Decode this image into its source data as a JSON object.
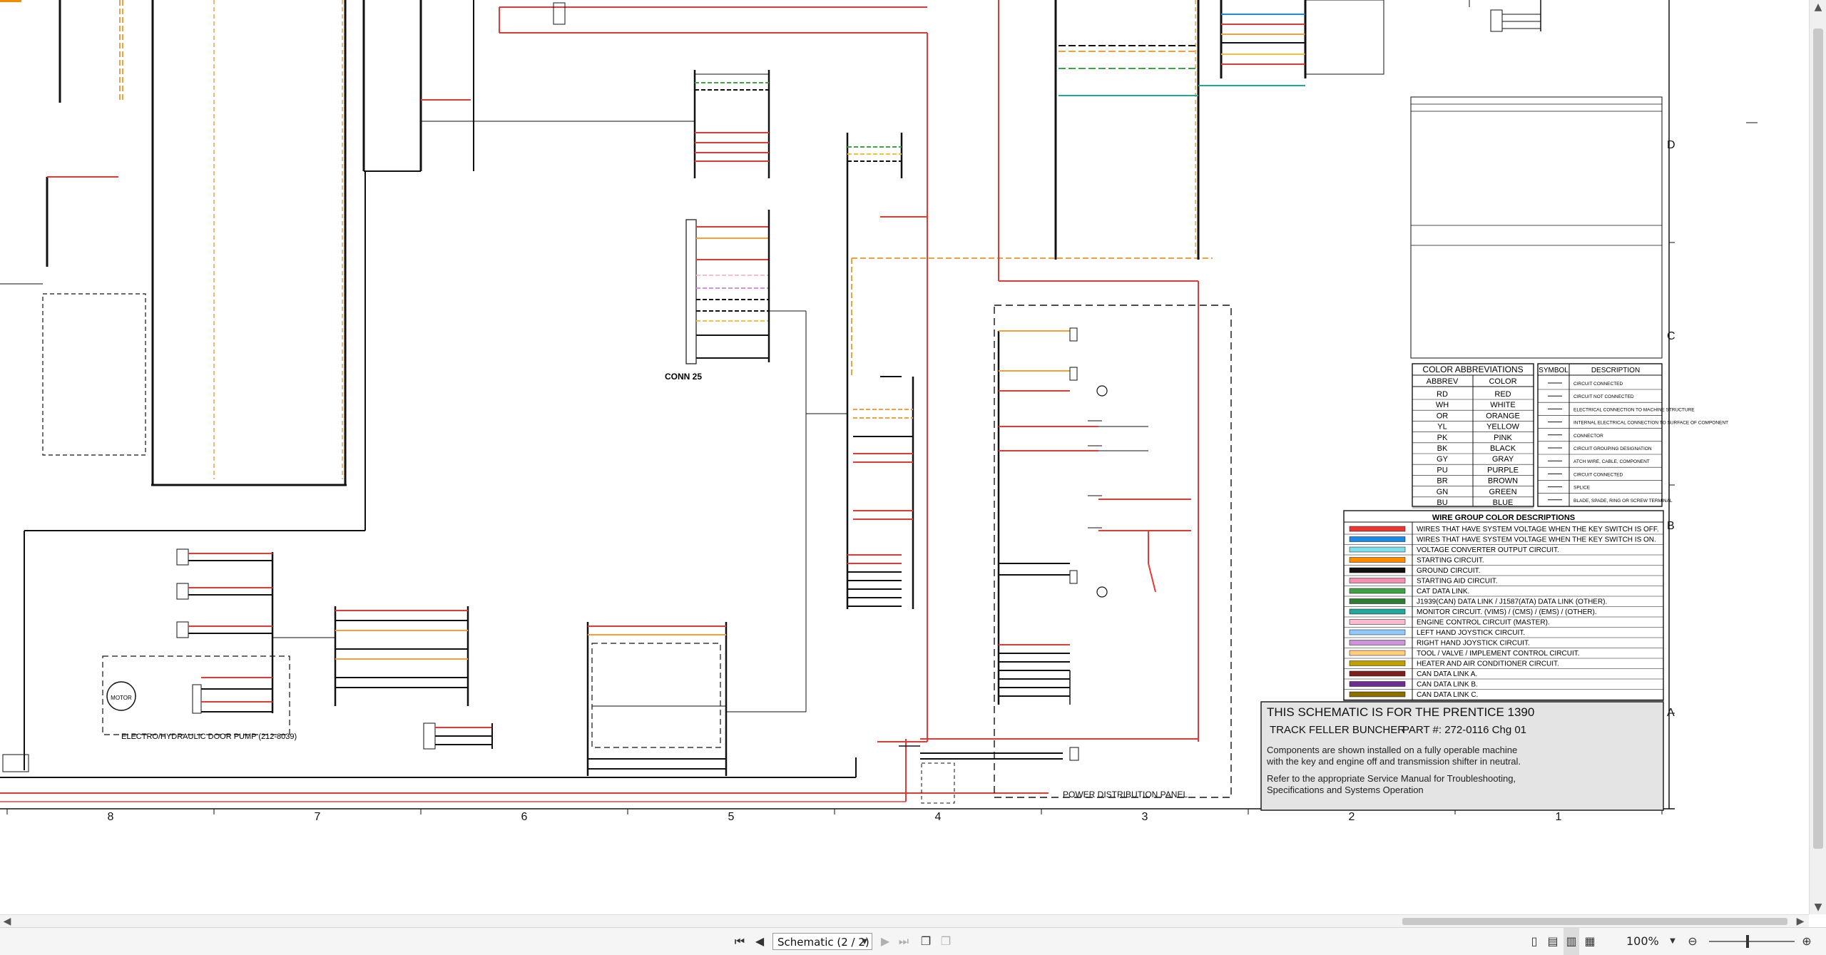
{
  "schematic": {
    "title_line1": "THIS SCHEMATIC IS FOR THE PRENTICE 1390",
    "title_line2_left": "TRACK FELLER BUNCHER",
    "title_line2_right": "PART #: 272-0116  Chg 01",
    "note1": "Components are shown installed on a fully operable machine",
    "note2": "with the key and engine off and transmission shifter in neutral.",
    "note3": "Refer to the appropriate Service Manual for Troubleshooting,",
    "note4": "Specifications and Systems Operation",
    "conn25": "CONN 25",
    "power_dist": "POWER DISTRIBUTION PANEL",
    "door_pump": "ELECTRO/HYDRAULIC DOOR PUMP (212-8039)",
    "motor": "MOTOR",
    "zone_numbers": [
      "8",
      "7",
      "6",
      "5",
      "4",
      "3",
      "2",
      "1"
    ],
    "row_letters": [
      "D",
      "C",
      "B",
      "A"
    ]
  },
  "color_abbrev": {
    "header": "COLOR ABBREVIATIONS",
    "col1": "ABBREV",
    "col2": "COLOR",
    "rows": [
      [
        "RD",
        "RED"
      ],
      [
        "WH",
        "WHITE"
      ],
      [
        "OR",
        "ORANGE"
      ],
      [
        "YL",
        "YELLOW"
      ],
      [
        "PK",
        "PINK"
      ],
      [
        "BK",
        "BLACK"
      ],
      [
        "GY",
        "GRAY"
      ],
      [
        "PU",
        "PURPLE"
      ],
      [
        "BR",
        "BROWN"
      ],
      [
        "GN",
        "GREEN"
      ],
      [
        "BU",
        "BLUE"
      ]
    ]
  },
  "symbols": {
    "col1": "SYMBOL",
    "col2": "DESCRIPTION",
    "rows": [
      "CIRCUIT CONNECTED",
      "CIRCUIT NOT CONNECTED",
      "ELECTRICAL CONNECTION TO MACHINE STRUCTURE",
      "INTERNAL ELECTRICAL CONNECTION TO SURFACE OF COMPONENT",
      "CONNECTOR",
      "CIRCUIT GROUPING DESIGNATION",
      "ATCH WIRE, CABLE, COMPONENT",
      "CIRCUIT CONNECTED",
      "SPLICE",
      "BLADE, SPADE, RING OR SCREW TERMINAL"
    ]
  },
  "wire_groups": {
    "header": "WIRE GROUP COLOR DESCRIPTIONS",
    "rows": [
      {
        "color": "#e53935",
        "label": "WIRES THAT HAVE SYSTEM VOLTAGE WHEN THE KEY SWITCH IS OFF."
      },
      {
        "color": "#1e88e5",
        "label": "WIRES THAT HAVE SYSTEM VOLTAGE WHEN THE KEY SWITCH IS ON."
      },
      {
        "color": "#80deea",
        "label": "VOLTAGE CONVERTER OUTPUT CIRCUIT."
      },
      {
        "color": "#fb8c00",
        "label": "STARTING CIRCUIT."
      },
      {
        "color": "#111111",
        "label": "GROUND CIRCUIT."
      },
      {
        "color": "#f48fb1",
        "label": "STARTING AID CIRCUIT."
      },
      {
        "color": "#43a047",
        "label": "CAT DATA LINK."
      },
      {
        "color": "#2e7d32",
        "label": "J1939(CAN) DATA LINK / J1587(ATA) DATA LINK (OTHER)."
      },
      {
        "color": "#26a69a",
        "label": "MONITOR CIRCUIT. (VIMS) / (CMS) / (EMS) / (OTHER)."
      },
      {
        "color": "#f8bbd0",
        "label": "ENGINE CONTROL CIRCUIT (MASTER)."
      },
      {
        "color": "#90caf9",
        "label": "LEFT HAND JOYSTICK CIRCUIT."
      },
      {
        "color": "#ce93d8",
        "label": "RIGHT HAND JOYSTICK CIRCUIT."
      },
      {
        "color": "#ffcc80",
        "label": "TOOL / VALVE / IMPLEMENT CONTROL CIRCUIT."
      },
      {
        "color": "#c0a000",
        "label": "HEATER AND AIR CONDITIONER CIRCUIT."
      },
      {
        "color": "#7b1f1f",
        "label": "CAN DATA LINK A."
      },
      {
        "color": "#6d2f8f",
        "label": "CAN DATA LINK B."
      },
      {
        "color": "#8d6e00",
        "label": "CAN DATA LINK C."
      }
    ]
  },
  "toolbar": {
    "page_label": "Schematic (2 / 2)",
    "zoom": "100%"
  }
}
